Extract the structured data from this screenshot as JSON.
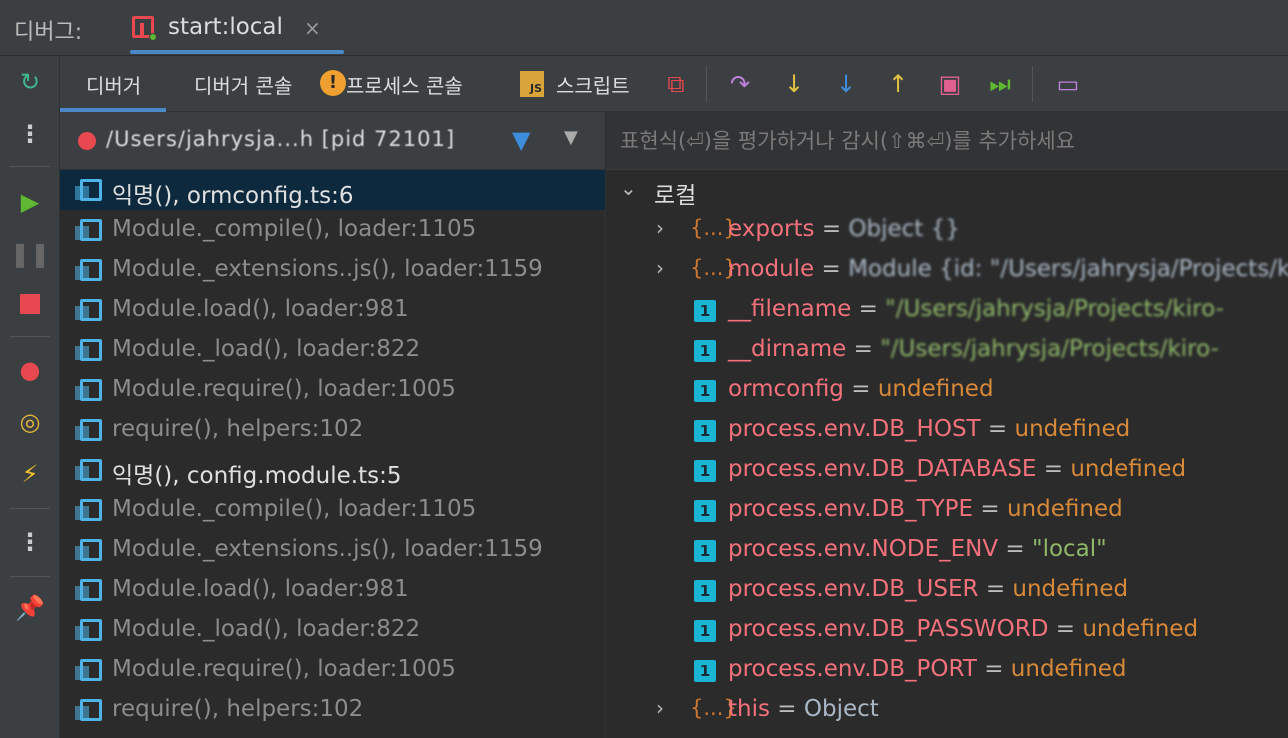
{
  "titlebar": {
    "label": "디버그:",
    "tab_name": "start:local",
    "close_glyph": "×"
  },
  "toolbar": {
    "tabs": [
      "디버거",
      "디버거 콘솔",
      "프로세스 콘솔",
      "스크립트"
    ],
    "warn_glyph": "!",
    "js_badge": "JS"
  },
  "frames": {
    "process_label": "/Users/jahrysja...h [pid 72101]",
    "items": [
      "익명(), ormconfig.ts:6",
      "Module._compile(), loader:1105",
      "Module._extensions..js(), loader:1159",
      "Module.load(), loader:981",
      "Module._load(), loader:822",
      "Module.require(), loader:1005",
      "require(), helpers:102",
      "익명(), config.module.ts:5",
      "Module._compile(), loader:1105",
      "Module._extensions..js(), loader:1159",
      "Module.load(), loader:981",
      "Module._load(), loader:822",
      "Module.require(), loader:1005",
      "require(), helpers:102"
    ]
  },
  "variables": {
    "expression_placeholder": "표현식(⏎)을 평가하거나 감시(⇧⌘⏎)를 추가하세요",
    "section": "로컬",
    "obj_glyph": "{...}",
    "prim_glyph": "1",
    "eq": "=",
    "exports": {
      "name": "exports",
      "value": "Object {}"
    },
    "module": {
      "name": "module",
      "value": "Module {id: \"/Users/jahrysja/Projects/kiro-"
    },
    "filename": {
      "name": "__filename",
      "value": "\"/Users/jahrysja/Projects/kiro-"
    },
    "dirname": {
      "name": "__dirname",
      "value": "\"/Users/jahrysja/Projects/kiro-"
    },
    "ormconfig": {
      "name": "ormconfig",
      "value": "undefined"
    },
    "db_host": {
      "name": "process.env.DB_HOST",
      "value": "undefined"
    },
    "db_database": {
      "name": "process.env.DB_DATABASE",
      "value": "undefined"
    },
    "db_type": {
      "name": "process.env.DB_TYPE",
      "value": "undefined"
    },
    "node_env": {
      "name": "process.env.NODE_ENV",
      "value": "\"local\""
    },
    "db_user": {
      "name": "process.env.DB_USER",
      "value": "undefined"
    },
    "db_password": {
      "name": "process.env.DB_PASSWORD",
      "value": "undefined"
    },
    "db_port": {
      "name": "process.env.DB_PORT",
      "value": "undefined"
    },
    "this": {
      "name": "this",
      "value": "Object"
    }
  },
  "colors": {
    "accent": "#4a88c7",
    "var_name": "#f3717b",
    "undefined": "#d68939",
    "string": "#8fb86a",
    "selected_row": "#0d293e"
  }
}
